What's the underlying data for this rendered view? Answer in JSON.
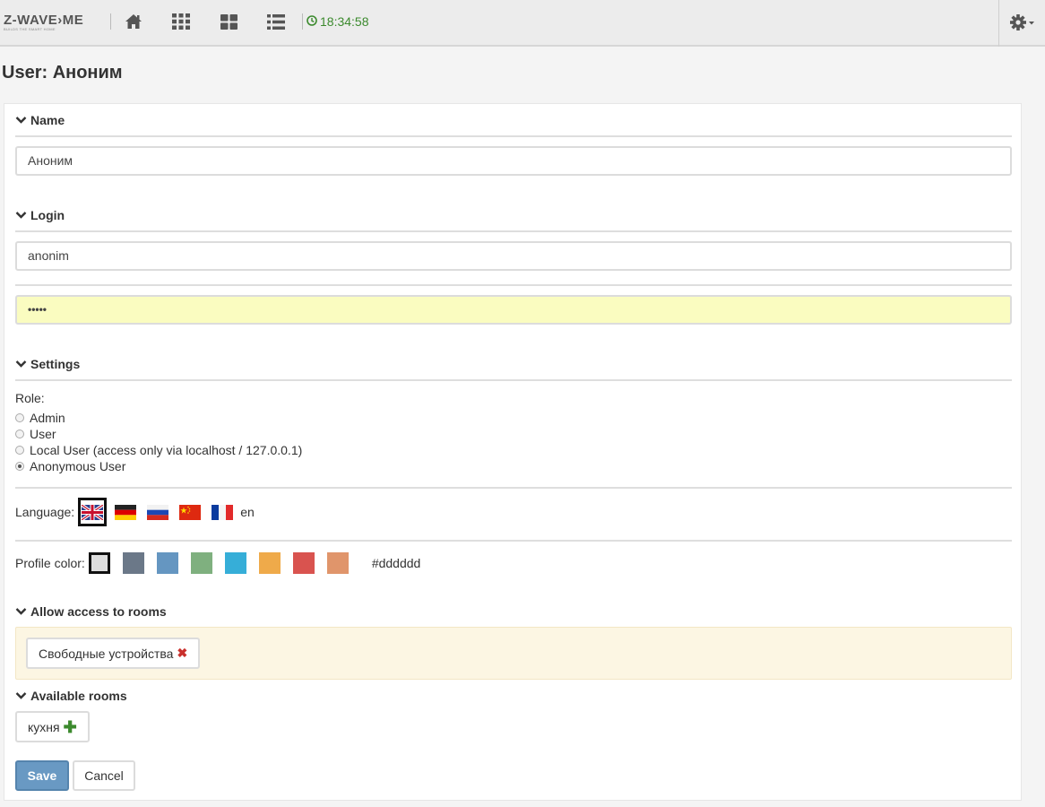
{
  "header": {
    "logo_text": "Z-WAVE›ME",
    "logo_tagline": "BUILDS THE SMART HOME",
    "clock": "18:34:58",
    "nav_icons": [
      "home-icon",
      "elements-grid-icon",
      "dashboard-icon",
      "list-icon"
    ],
    "settings_icon": "gear-icon"
  },
  "page": {
    "title": "User: Аноним"
  },
  "name_section": {
    "title": "Name",
    "value": "Аноним"
  },
  "login_section": {
    "title": "Login",
    "login_value": "anonim",
    "password_value": "•••••"
  },
  "settings_section": {
    "title": "Settings",
    "role_label": "Role:",
    "roles": [
      {
        "label": "Admin",
        "selected": false
      },
      {
        "label": "User",
        "selected": false
      },
      {
        "label": "Local User (access only via localhost / 127.0.0.1)",
        "selected": false
      },
      {
        "label": "Anonymous User",
        "selected": true
      }
    ],
    "language_label": "Language:",
    "languages": [
      "gb",
      "de",
      "ru",
      "cn",
      "fr"
    ],
    "selected_language": "en",
    "profile_color_label": "Profile color:",
    "colors": [
      "#dddddd",
      "#6b7888",
      "#6596c1",
      "#7fb07f",
      "#36aed8",
      "#efaa4a",
      "#d9534f",
      "#e0956b"
    ],
    "selected_color": "#dddddd"
  },
  "rooms_access": {
    "title": "Allow access to rooms",
    "rooms": [
      "Свободные устройства"
    ]
  },
  "available_rooms": {
    "title": "Available rooms",
    "rooms": [
      "кухня"
    ]
  },
  "actions": {
    "save_label": "Save",
    "cancel_label": "Cancel"
  },
  "colors": {
    "accent": "#6999c3",
    "clock_green": "#3c8a2e",
    "remove_red": "#c9302c"
  }
}
